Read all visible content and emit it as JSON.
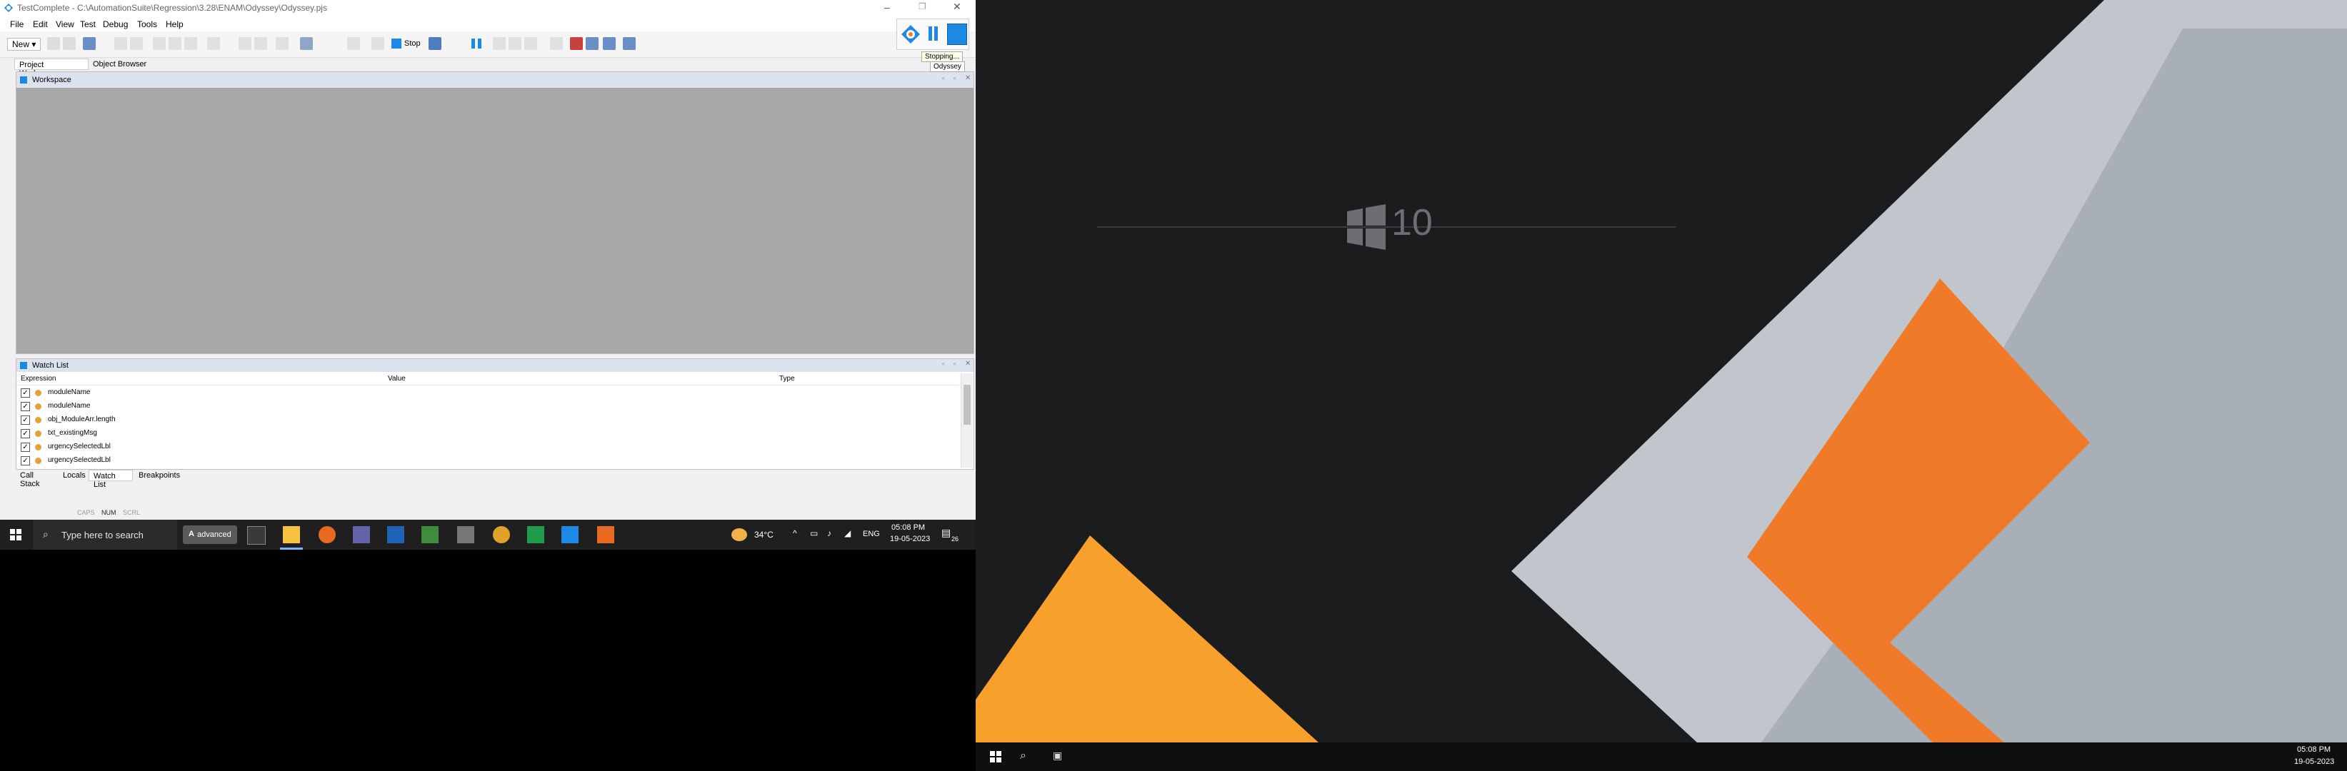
{
  "window": {
    "title": "TestComplete - C:\\AutomationSuite\\Regression\\3.28\\ENAM\\Odyssey\\Odyssey.pjs",
    "menu": [
      "File",
      "Edit",
      "View",
      "Test",
      "Debug",
      "Tools",
      "Help"
    ],
    "toolbar": {
      "new_label": "New",
      "stop_label": "Stop"
    },
    "tabs": [
      "Project Workspace",
      "Object Browser"
    ],
    "workspace_title": "Workspace",
    "watch_list": {
      "title": "Watch List",
      "columns": [
        "Expression",
        "Value",
        "Type"
      ],
      "rows": [
        {
          "checked": true,
          "expression": "moduleName"
        },
        {
          "checked": true,
          "expression": "moduleName"
        },
        {
          "checked": true,
          "expression": "obj_ModuleArr.length"
        },
        {
          "checked": true,
          "expression": "txt_existingMsg"
        },
        {
          "checked": true,
          "expression": "urgencySelectedLbl"
        },
        {
          "checked": true,
          "expression": "urgencySelectedLbl"
        }
      ]
    },
    "bottom_tabs": [
      "Call Stack",
      "Locals",
      "Watch List",
      "Breakpoints"
    ],
    "status": {
      "caps": "CAPS",
      "num": "NUM",
      "scrl": "SCRL"
    },
    "floating_toolbar": {
      "tooltip_stopping": "Stopping...",
      "tooltip_project": "Odyssey"
    }
  },
  "taskbar_left": {
    "search_placeholder": "Type here to search",
    "advanced_label": "advanced",
    "weather": "34°C",
    "lang": "ENG",
    "time": "05:08 PM",
    "date": "19-05-2023",
    "notification_count": "26"
  },
  "desktop_right": {
    "logo_text": "10",
    "time": "05:08 PM",
    "date": "19-05-2023"
  },
  "colors": {
    "accent_blue": "#1e88e5",
    "orange": "#f07a28",
    "orange_light": "#f7a02b",
    "gray_light": "#c0c6cc",
    "desktop_dark": "#1b1c1e"
  }
}
